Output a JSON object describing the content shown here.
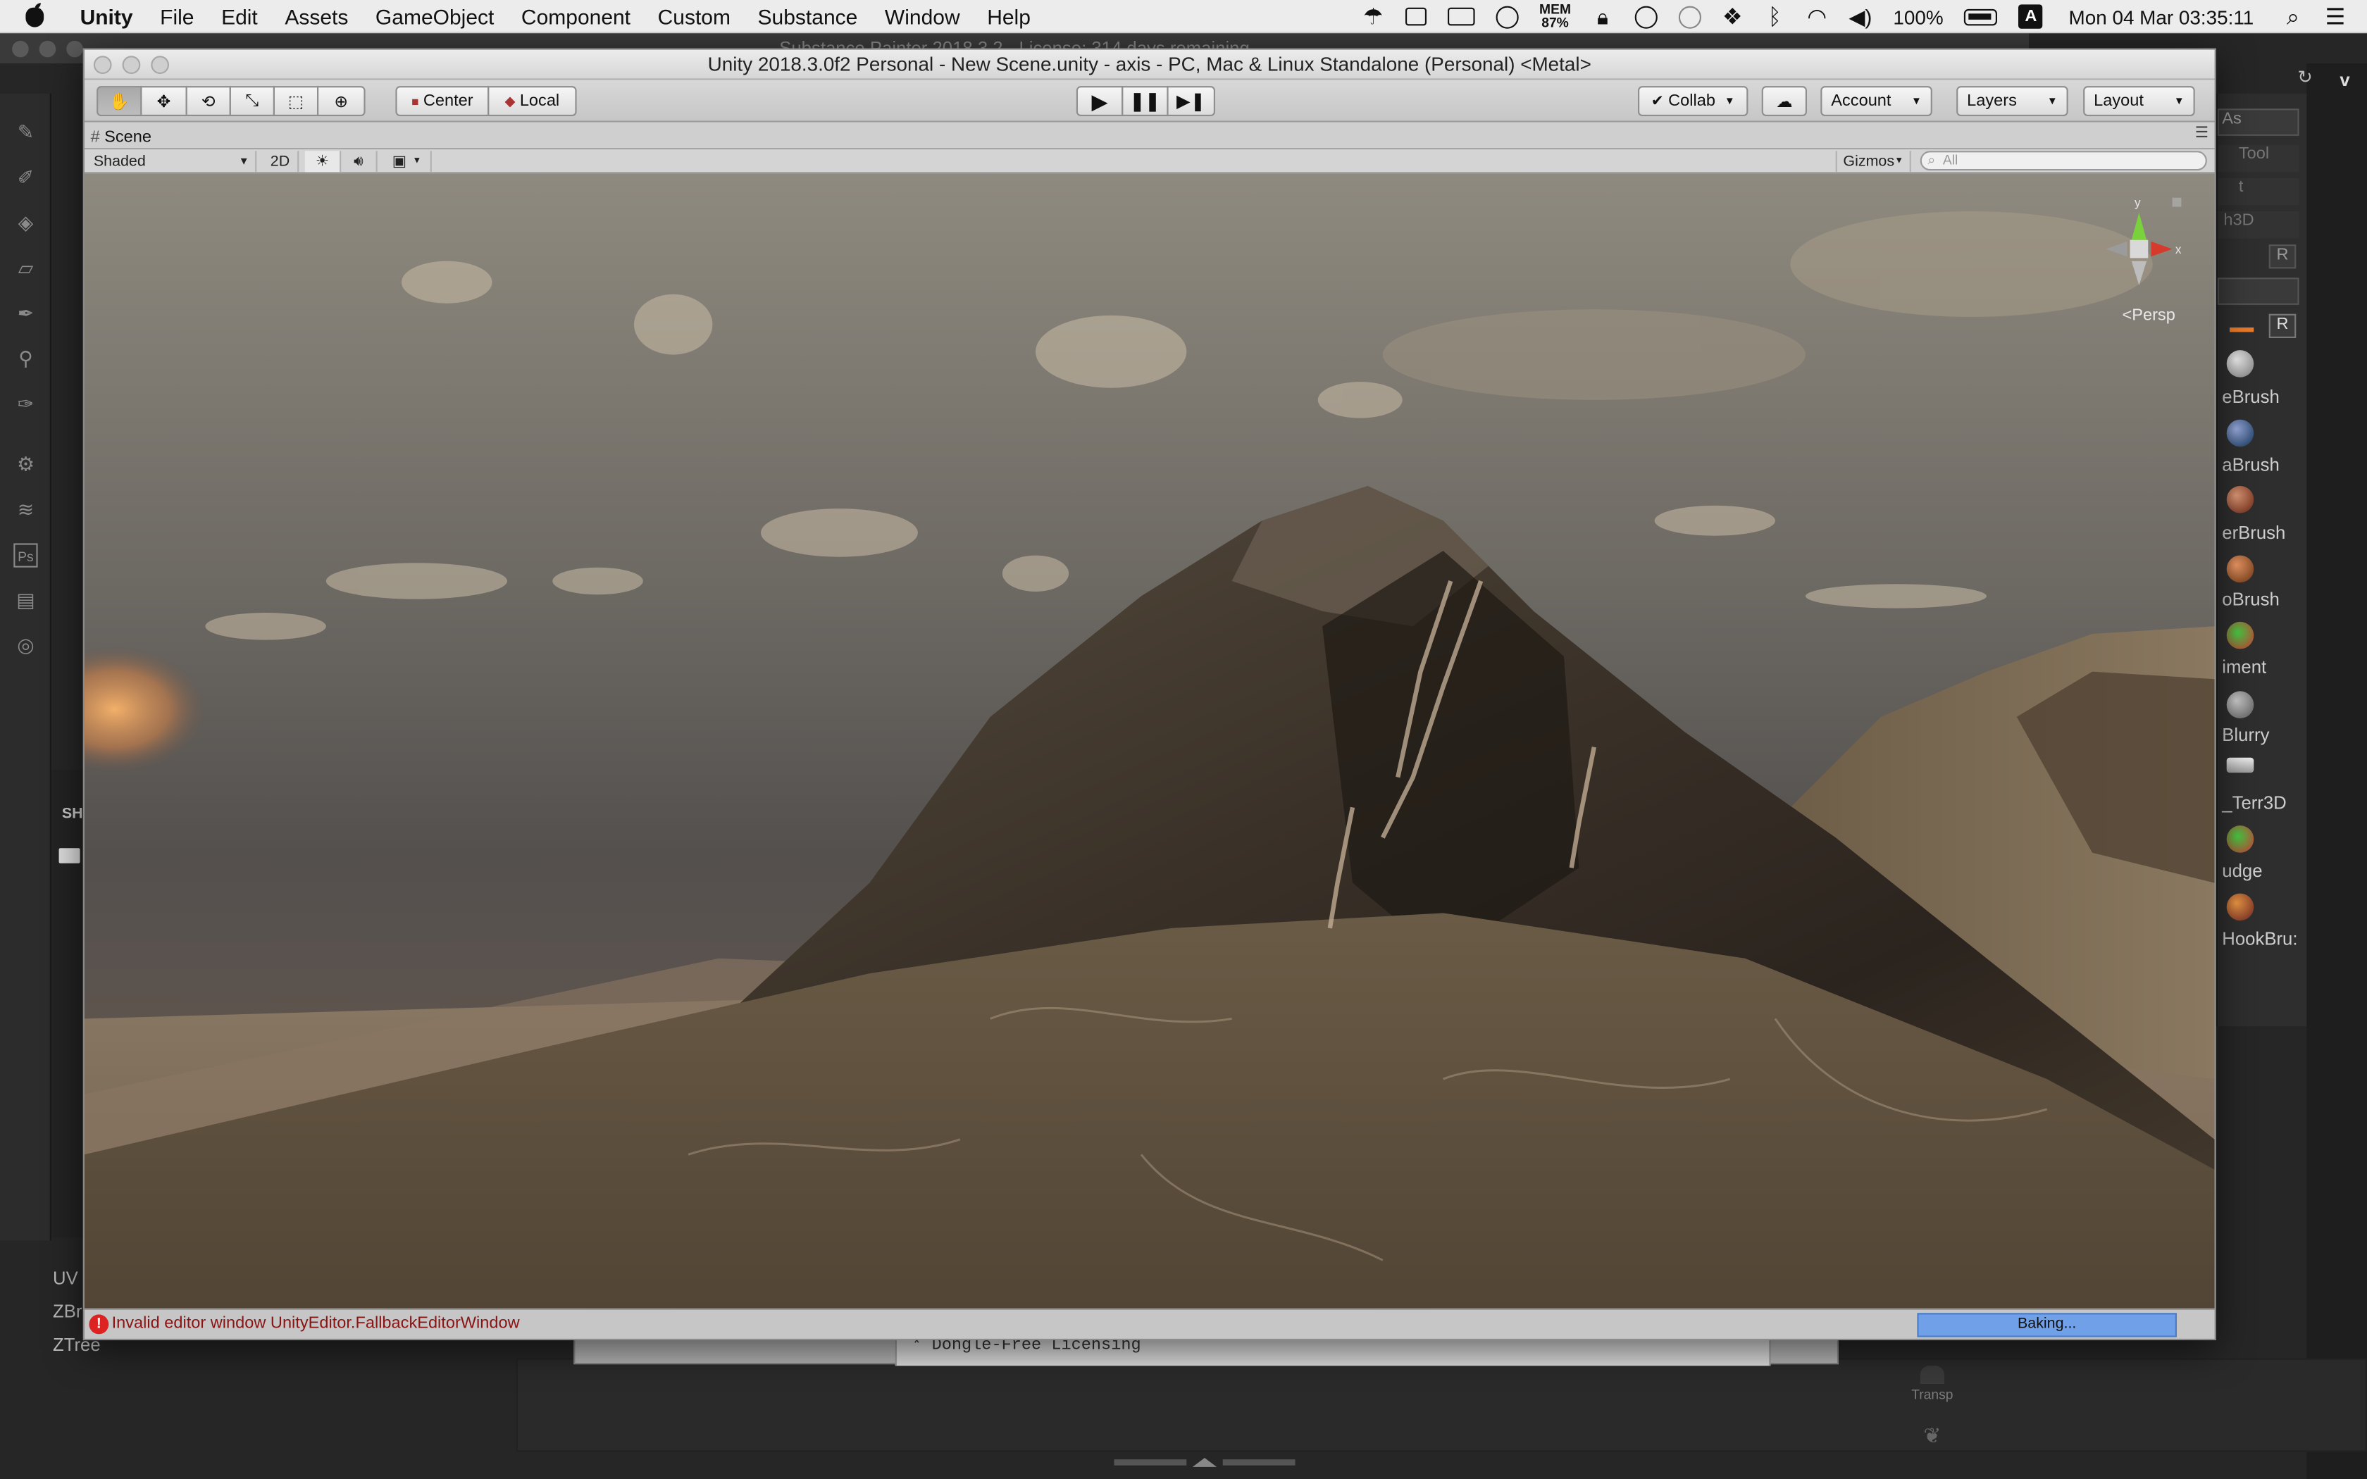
{
  "menubar": {
    "app_name": "Unity",
    "items": [
      "File",
      "Edit",
      "Assets",
      "GameObject",
      "Component",
      "Custom",
      "Substance",
      "Window",
      "Help"
    ],
    "status": {
      "mem_label": "MEM",
      "mem_value": "87%",
      "battery": "100%",
      "clock": "Mon 04 Mar  03:35:11",
      "input_source": "A"
    }
  },
  "background": {
    "substance_title": "Substance Painter 2018.3.2 - License: 314 days remaining",
    "zbrush_list": [
      "UV M",
      "ZBru",
      "ZTree"
    ],
    "brushes": [
      "eBrush",
      "aBrush",
      "erBrush",
      "oBrush",
      "iment",
      "Blurry",
      "_Terr3D",
      "udge",
      "HookBru:"
    ],
    "top_items": [
      "As",
      "Tool",
      "t",
      "h3D",
      "R",
      "R"
    ],
    "left_label": "SH",
    "code_line": "* Dongle-Free Licensing",
    "transp_label": "Transp"
  },
  "unity": {
    "title": "Unity 2018.3.0f2 Personal - New Scene.unity - axis - PC, Mac & Linux Standalone (Personal) <Metal>",
    "toolbar": {
      "center_label": "Center",
      "local_label": "Local",
      "collab_label": "Collab",
      "account_label": "Account",
      "layers_label": "Layers",
      "layout_label": "Layout"
    },
    "scene_tab": "Scene",
    "scene_toolbar": {
      "draw_mode": "Shaded",
      "mode_2d": "2D",
      "gizmos_label": "Gizmos",
      "search_placeholder": "All"
    },
    "viewport": {
      "projection": "Persp",
      "axis_y": "y",
      "axis_x": "x"
    },
    "status": {
      "error_message": "Invalid editor window UnityEditor.FallbackEditorWindow",
      "progress_label": "Baking..."
    }
  },
  "colors": {
    "error_red": "#8a1414",
    "progress_blue": "#6fa0e8",
    "axis_y": "#7ad13b",
    "axis_x": "#d53b2d"
  }
}
